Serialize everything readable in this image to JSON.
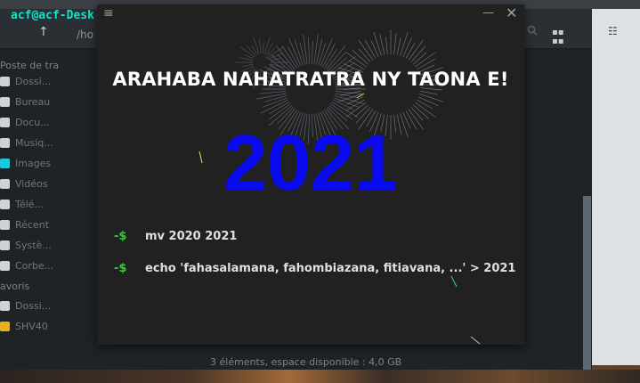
{
  "file_manager": {
    "title": "acf@acf-Desk",
    "path": "/ho",
    "sidebar": {
      "header_places": "Poste de tra",
      "items": [
        "Dossi...",
        "Bureau",
        "Docu...",
        "Musiq...",
        "Images",
        "Vidéos",
        "Télé...",
        "Récent",
        "Systè...",
        "Corbe..."
      ],
      "header_favorites": "avoris",
      "favorites": [
        "Dossi...",
        "SHV40"
      ]
    },
    "status": "3 éléments, espace disponible : 4,0 GB"
  },
  "terminal": {
    "greeting": "ARAHABA NAHATRATRA NY TAONA E!",
    "year": "2021",
    "commands": [
      {
        "prompt": "-$",
        "text": "mv 2020 2021"
      },
      {
        "prompt": "-$",
        "text": "echo 'fahasalamana, fahombiazana, fitiavana, ...' > 2021"
      }
    ]
  },
  "colors": {
    "prompt_green": "#2fd12f",
    "year_blue": "#0a0af0",
    "title_cyan": "#19e0c8",
    "terminal_bg": "#212121"
  },
  "icons": [
    "menu-icon",
    "minimize-icon",
    "close-icon",
    "search-icon",
    "grid-view-icon",
    "list-view-icon",
    "up-arrow-icon"
  ]
}
